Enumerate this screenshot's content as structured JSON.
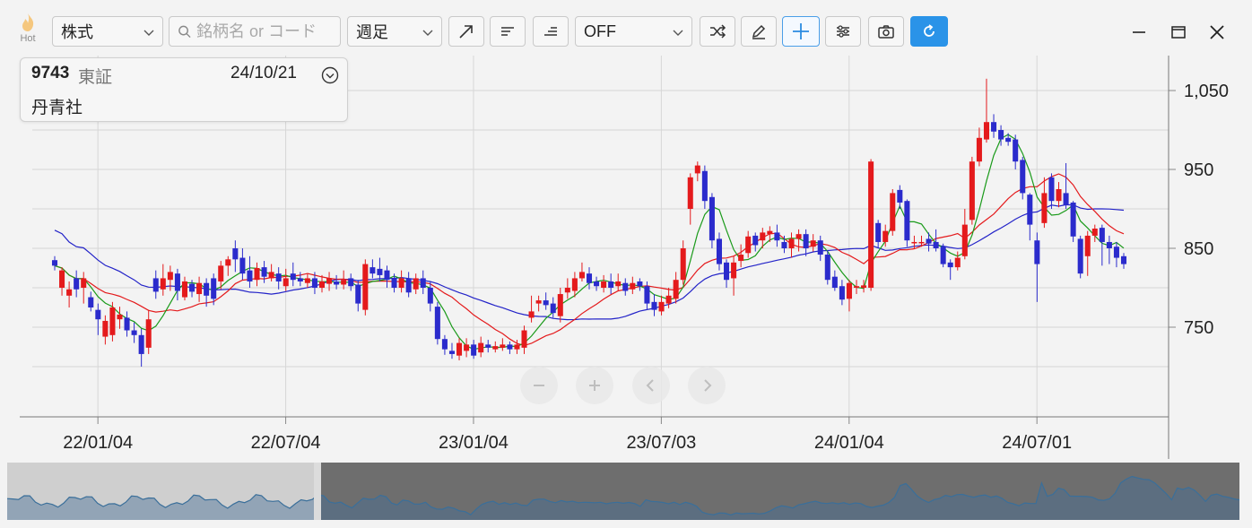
{
  "toolbar": {
    "hot_label": "Hot",
    "market_type": "株式",
    "search_placeholder": "銘柄名 or コード",
    "period": "週足",
    "overlay": "OFF",
    "buttons": [
      "trend-line-icon",
      "left-align-icon",
      "right-align-icon",
      "shuffle-icon",
      "pencil-icon",
      "crosshair-icon",
      "settings-sliders-icon",
      "camera-icon",
      "refresh-icon"
    ]
  },
  "window": {
    "minimize": "minimize-icon",
    "maximize": "maximize-icon",
    "close": "close-icon"
  },
  "info": {
    "code": "9743",
    "market": "東証",
    "date": "24/10/21",
    "name": "丹青社"
  },
  "colors": {
    "up": "#e41a1c",
    "down": "#2b2bcc",
    "ma_short": "#1a9a1a",
    "ma_mid": "#e41a1c",
    "ma_long": "#2323c8",
    "accent": "#2a93e8"
  },
  "chart_data": {
    "type": "candlestick",
    "y_ticks": [
      "1,050",
      "950",
      "850",
      "750"
    ],
    "y_tick_values": [
      1050,
      950,
      850,
      750
    ],
    "ylim": [
      690,
      1075
    ],
    "x_ticks": [
      "22/01/04",
      "22/07/04",
      "23/01/04",
      "23/07/03",
      "24/01/04",
      "24/07/01"
    ],
    "x_tick_index": [
      3,
      29,
      55,
      81,
      107,
      133
    ],
    "candles": [
      [
        835,
        828,
        840,
        822
      ],
      [
        800,
        822,
        826,
        790
      ],
      [
        790,
        798,
        808,
        775
      ],
      [
        812,
        798,
        822,
        788
      ],
      [
        800,
        812,
        820,
        780
      ],
      [
        788,
        775,
        795,
        770
      ],
      [
        772,
        760,
        780,
        740
      ],
      [
        738,
        758,
        765,
        728
      ],
      [
        740,
        775,
        782,
        732
      ],
      [
        760,
        766,
        776,
        748
      ],
      [
        762,
        746,
        770,
        738
      ],
      [
        746,
        740,
        756,
        730
      ],
      [
        740,
        716,
        748,
        700
      ],
      [
        724,
        760,
        772,
        716
      ],
      [
        812,
        795,
        822,
        786
      ],
      [
        798,
        812,
        830,
        790
      ],
      [
        810,
        820,
        828,
        796
      ],
      [
        818,
        796,
        824,
        784
      ],
      [
        788,
        808,
        814,
        784
      ],
      [
        805,
        795,
        810,
        788
      ],
      [
        792,
        806,
        814,
        782
      ],
      [
        806,
        790,
        812,
        776
      ],
      [
        812,
        786,
        818,
        778
      ],
      [
        808,
        828,
        834,
        798
      ],
      [
        828,
        836,
        840,
        815
      ],
      [
        850,
        836,
        860,
        820
      ],
      [
        838,
        818,
        850,
        810
      ],
      [
        822,
        808,
        840,
        800
      ],
      [
        810,
        825,
        832,
        802
      ],
      [
        826,
        814,
        834,
        806
      ],
      [
        812,
        820,
        830,
        808
      ],
      [
        818,
        808,
        826,
        798
      ],
      [
        802,
        812,
        824,
        796
      ],
      [
        818,
        810,
        832,
        802
      ],
      [
        812,
        808,
        820,
        802
      ],
      [
        806,
        812,
        818,
        800
      ],
      [
        812,
        800,
        820,
        792
      ],
      [
        800,
        808,
        816,
        794
      ],
      [
        805,
        812,
        820,
        796
      ],
      [
        808,
        804,
        816,
        798
      ],
      [
        804,
        810,
        822,
        798
      ],
      [
        812,
        802,
        818,
        796
      ],
      [
        804,
        780,
        810,
        770
      ],
      [
        772,
        830,
        836,
        765
      ],
      [
        826,
        818,
        836,
        812
      ],
      [
        824,
        816,
        838,
        808
      ],
      [
        822,
        810,
        828,
        800
      ],
      [
        812,
        800,
        818,
        794
      ],
      [
        800,
        812,
        822,
        794
      ],
      [
        812,
        794,
        820,
        788
      ],
      [
        798,
        812,
        818,
        792
      ],
      [
        812,
        800,
        822,
        792
      ],
      [
        800,
        780,
        808,
        770
      ],
      [
        776,
        735,
        782,
        728
      ],
      [
        735,
        722,
        740,
        715
      ],
      [
        720,
        716,
        730,
        710
      ],
      [
        714,
        730,
        736,
        708
      ],
      [
        720,
        728,
        736,
        712
      ],
      [
        728,
        714,
        734,
        710
      ],
      [
        718,
        730,
        738,
        712
      ],
      [
        728,
        724,
        734,
        718
      ],
      [
        722,
        726,
        732,
        718
      ],
      [
        724,
        728,
        736,
        720
      ],
      [
        728,
        722,
        732,
        716
      ],
      [
        722,
        728,
        734,
        716
      ],
      [
        724,
        746,
        752,
        716
      ],
      [
        762,
        770,
        790,
        756
      ],
      [
        780,
        784,
        790,
        770
      ],
      [
        784,
        778,
        794,
        772
      ],
      [
        780,
        768,
        788,
        762
      ],
      [
        764,
        792,
        800,
        756
      ],
      [
        794,
        800,
        812,
        786
      ],
      [
        796,
        812,
        820,
        788
      ],
      [
        812,
        820,
        832,
        808
      ],
      [
        818,
        806,
        826,
        798
      ],
      [
        808,
        802,
        814,
        796
      ],
      [
        800,
        808,
        816,
        794
      ],
      [
        808,
        800,
        818,
        792
      ],
      [
        802,
        808,
        818,
        796
      ],
      [
        806,
        796,
        812,
        790
      ],
      [
        798,
        806,
        814,
        792
      ],
      [
        808,
        802,
        812,
        796
      ],
      [
        802,
        780,
        808,
        772
      ],
      [
        782,
        772,
        792,
        764
      ],
      [
        770,
        782,
        790,
        765
      ],
      [
        780,
        790,
        800,
        774
      ],
      [
        786,
        810,
        820,
        780
      ],
      [
        810,
        850,
        860,
        804
      ],
      [
        900,
        940,
        945,
        880
      ],
      [
        945,
        955,
        960,
        935
      ],
      [
        948,
        910,
        955,
        900
      ],
      [
        915,
        860,
        920,
        850
      ],
      [
        862,
        830,
        870,
        822
      ],
      [
        832,
        810,
        836,
        800
      ],
      [
        812,
        832,
        840,
        790
      ],
      [
        834,
        842,
        855,
        826
      ],
      [
        844,
        865,
        872,
        838
      ],
      [
        866,
        854,
        870,
        846
      ],
      [
        860,
        870,
        876,
        850
      ],
      [
        868,
        872,
        878,
        858
      ],
      [
        870,
        860,
        880,
        852
      ],
      [
        858,
        850,
        866,
        844
      ],
      [
        850,
        862,
        870,
        838
      ],
      [
        862,
        868,
        874,
        846
      ],
      [
        868,
        850,
        874,
        840
      ],
      [
        852,
        860,
        868,
        846
      ],
      [
        860,
        842,
        866,
        834
      ],
      [
        842,
        810,
        848,
        804
      ],
      [
        814,
        800,
        822,
        796
      ],
      [
        802,
        785,
        810,
        778
      ],
      [
        786,
        806,
        810,
        770
      ],
      [
        800,
        802,
        810,
        792
      ],
      [
        800,
        803,
        810,
        794
      ],
      [
        800,
        960,
        963,
        796
      ],
      [
        882,
        858,
        886,
        850
      ],
      [
        858,
        872,
        880,
        852
      ],
      [
        872,
        920,
        925,
        866
      ],
      [
        924,
        908,
        930,
        900
      ],
      [
        910,
        860,
        912,
        852
      ],
      [
        858,
        858,
        866,
        850
      ],
      [
        858,
        858,
        866,
        852
      ],
      [
        862,
        856,
        870,
        846
      ],
      [
        858,
        850,
        874,
        846
      ],
      [
        852,
        830,
        856,
        826
      ],
      [
        832,
        826,
        836,
        810
      ],
      [
        826,
        838,
        846,
        822
      ],
      [
        840,
        880,
        900,
        836
      ],
      [
        886,
        960,
        966,
        880
      ],
      [
        960,
        990,
        1003,
        954
      ],
      [
        988,
        1010,
        1065,
        984
      ],
      [
        1010,
        998,
        1020,
        990
      ],
      [
        1000,
        988,
        1006,
        980
      ],
      [
        990,
        985,
        996,
        980
      ],
      [
        988,
        960,
        994,
        950
      ],
      [
        962,
        920,
        966,
        912
      ],
      [
        918,
        880,
        920,
        860
      ],
      [
        860,
        830,
        870,
        782
      ],
      [
        882,
        920,
        940,
        876
      ],
      [
        940,
        910,
        945,
        900
      ],
      [
        910,
        925,
        934,
        902
      ],
      [
        920,
        905,
        958,
        900
      ],
      [
        908,
        865,
        910,
        858
      ],
      [
        862,
        818,
        866,
        812
      ],
      [
        840,
        866,
        872,
        815
      ],
      [
        866,
        875,
        880,
        858
      ],
      [
        876,
        858,
        880,
        828
      ],
      [
        858,
        850,
        866,
        830
      ],
      [
        852,
        838,
        858,
        826
      ],
      [
        840,
        830,
        844,
        824
      ]
    ]
  },
  "navigator": {
    "selected_range": "22/01–24/10"
  },
  "zoom_controls": [
    "minus-icon",
    "plus-icon",
    "chevron-left-icon",
    "chevron-right-icon"
  ]
}
